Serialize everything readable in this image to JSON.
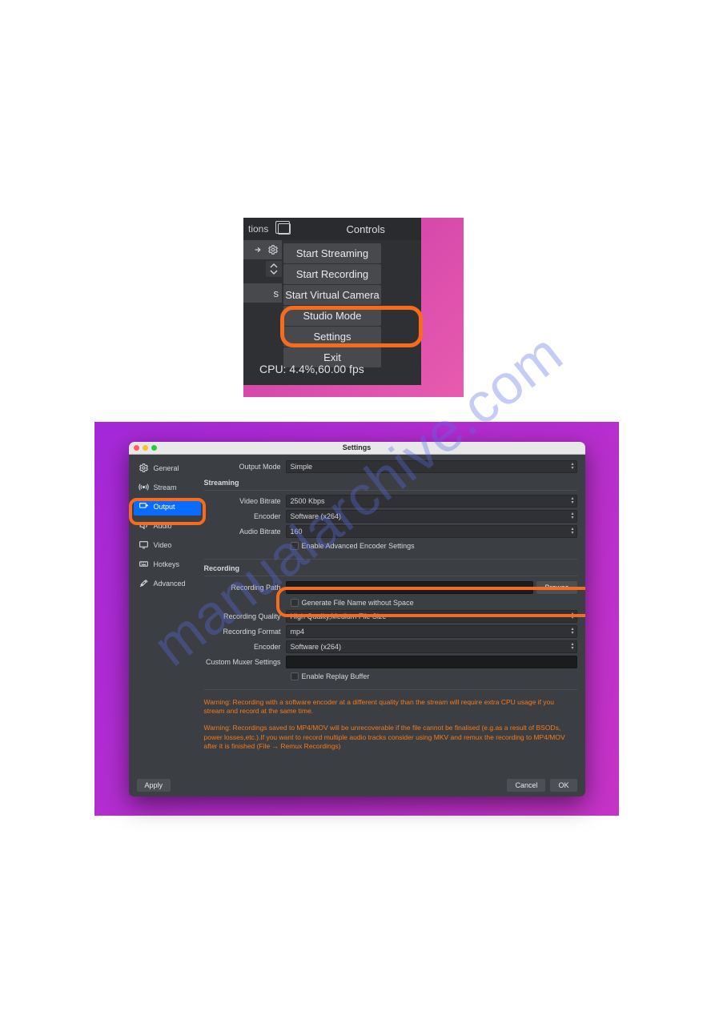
{
  "watermark": "manualarchive.com",
  "shot1": {
    "tab_fragment": "tions",
    "controls_header": "Controls",
    "left_s_char": "s",
    "buttons": {
      "streaming": "Start Streaming",
      "recording": "Start Recording",
      "virtualcam": "Start Virtual Camera",
      "studio": "Studio Mode",
      "settings": "Settings",
      "exit": "Exit"
    },
    "status": "CPU: 4.4%,60.00 fps"
  },
  "shot2": {
    "window_title": "Settings",
    "sidebar": {
      "items": [
        {
          "key": "general",
          "label": "General"
        },
        {
          "key": "stream",
          "label": "Stream"
        },
        {
          "key": "output",
          "label": "Output"
        },
        {
          "key": "audio",
          "label": "Audio"
        },
        {
          "key": "video",
          "label": "Video"
        },
        {
          "key": "hotkeys",
          "label": "Hotkeys"
        },
        {
          "key": "advanced",
          "label": "Advanced"
        }
      ]
    },
    "output_mode": {
      "label": "Output Mode",
      "value": "Simple"
    },
    "streaming": {
      "header": "Streaming",
      "video_bitrate": {
        "label": "Video Bitrate",
        "value": "2500 Kbps"
      },
      "encoder": {
        "label": "Encoder",
        "value": "Software (x264)"
      },
      "audio_bitrate": {
        "label": "Audio Bitrate",
        "value": "160"
      },
      "adv_enc": "Enable Advanced Encoder Settings"
    },
    "recording": {
      "header": "Recording",
      "path": {
        "label": "Recording Path",
        "value": ""
      },
      "browse": "Browse",
      "gen_fname": "Generate File Name without Space",
      "quality": {
        "label": "Recording Quality",
        "value": "High Quality,Medium File Size"
      },
      "format": {
        "label": "Recording Format",
        "value": "mp4"
      },
      "encoder": {
        "label": "Encoder",
        "value": "Software (x264)"
      },
      "muxer": {
        "label": "Custom Muxer Settings",
        "value": ""
      },
      "replay": "Enable Replay Buffer"
    },
    "warnings": {
      "w1": "Warning: Recording with a software encoder at a different quality than the stream will require extra CPU usage if you stream and record at the same time.",
      "w2": "Warning: Recordings saved to MP4/MOV will be unrecoverable if the file cannot be finalised (e.g.as a result of BSODs, power losses,etc.).If you want to record multiple audio tracks consider using MKV and remux the recording to MP4/MOV after it is finished (File → Remux Recordings)"
    },
    "footer": {
      "apply": "Apply",
      "cancel": "Cancel",
      "ok": "OK"
    }
  }
}
